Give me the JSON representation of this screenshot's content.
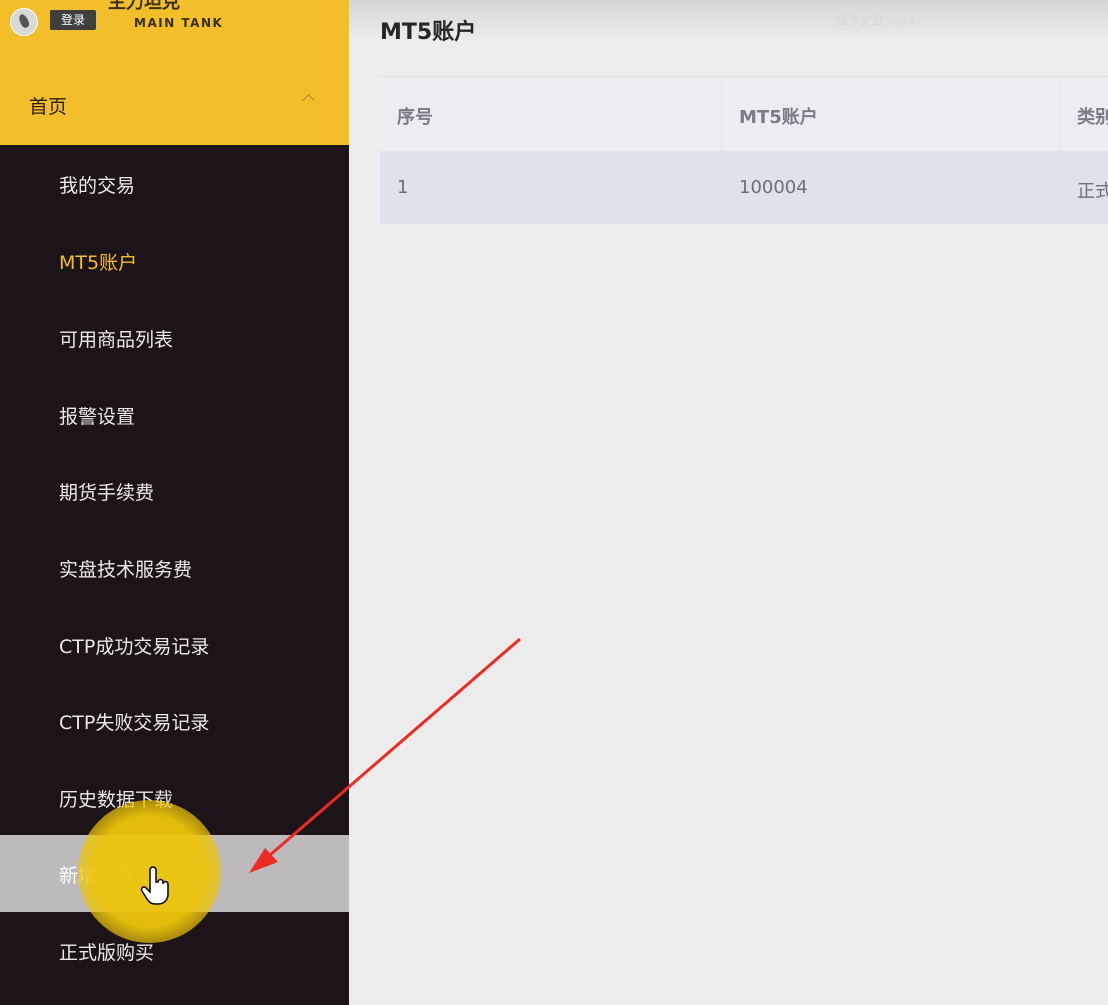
{
  "brand": {
    "login_label": "登录",
    "brand_name": "MAIN TANK",
    "brand_top_text": "主力坦克"
  },
  "sidebar": {
    "home_label": "首页",
    "items": [
      {
        "label": "我的交易"
      },
      {
        "label": "MT5账户",
        "state": "active"
      },
      {
        "label": "可用商品列表"
      },
      {
        "label": "报警设置"
      },
      {
        "label": "期货手续费"
      },
      {
        "label": "实盘技术服务费"
      },
      {
        "label": "CTP成功交易记录"
      },
      {
        "label": "CTP失败交易记录"
      },
      {
        "label": "历史数据下载"
      },
      {
        "label": "新增交易账号",
        "state": "hover"
      },
      {
        "label": "正式版购买"
      }
    ]
  },
  "main": {
    "page_title": "MT5账户",
    "video_title": "操手文章.mp4",
    "table": {
      "headers": [
        "序号",
        "MT5账户",
        "类别"
      ],
      "rows": [
        [
          "1",
          "100004",
          "正式"
        ]
      ]
    }
  },
  "colors": {
    "accent": "#f2bf2b",
    "sidebar_bg": "#1d1419",
    "annotation_arrow": "#ee2a24"
  }
}
